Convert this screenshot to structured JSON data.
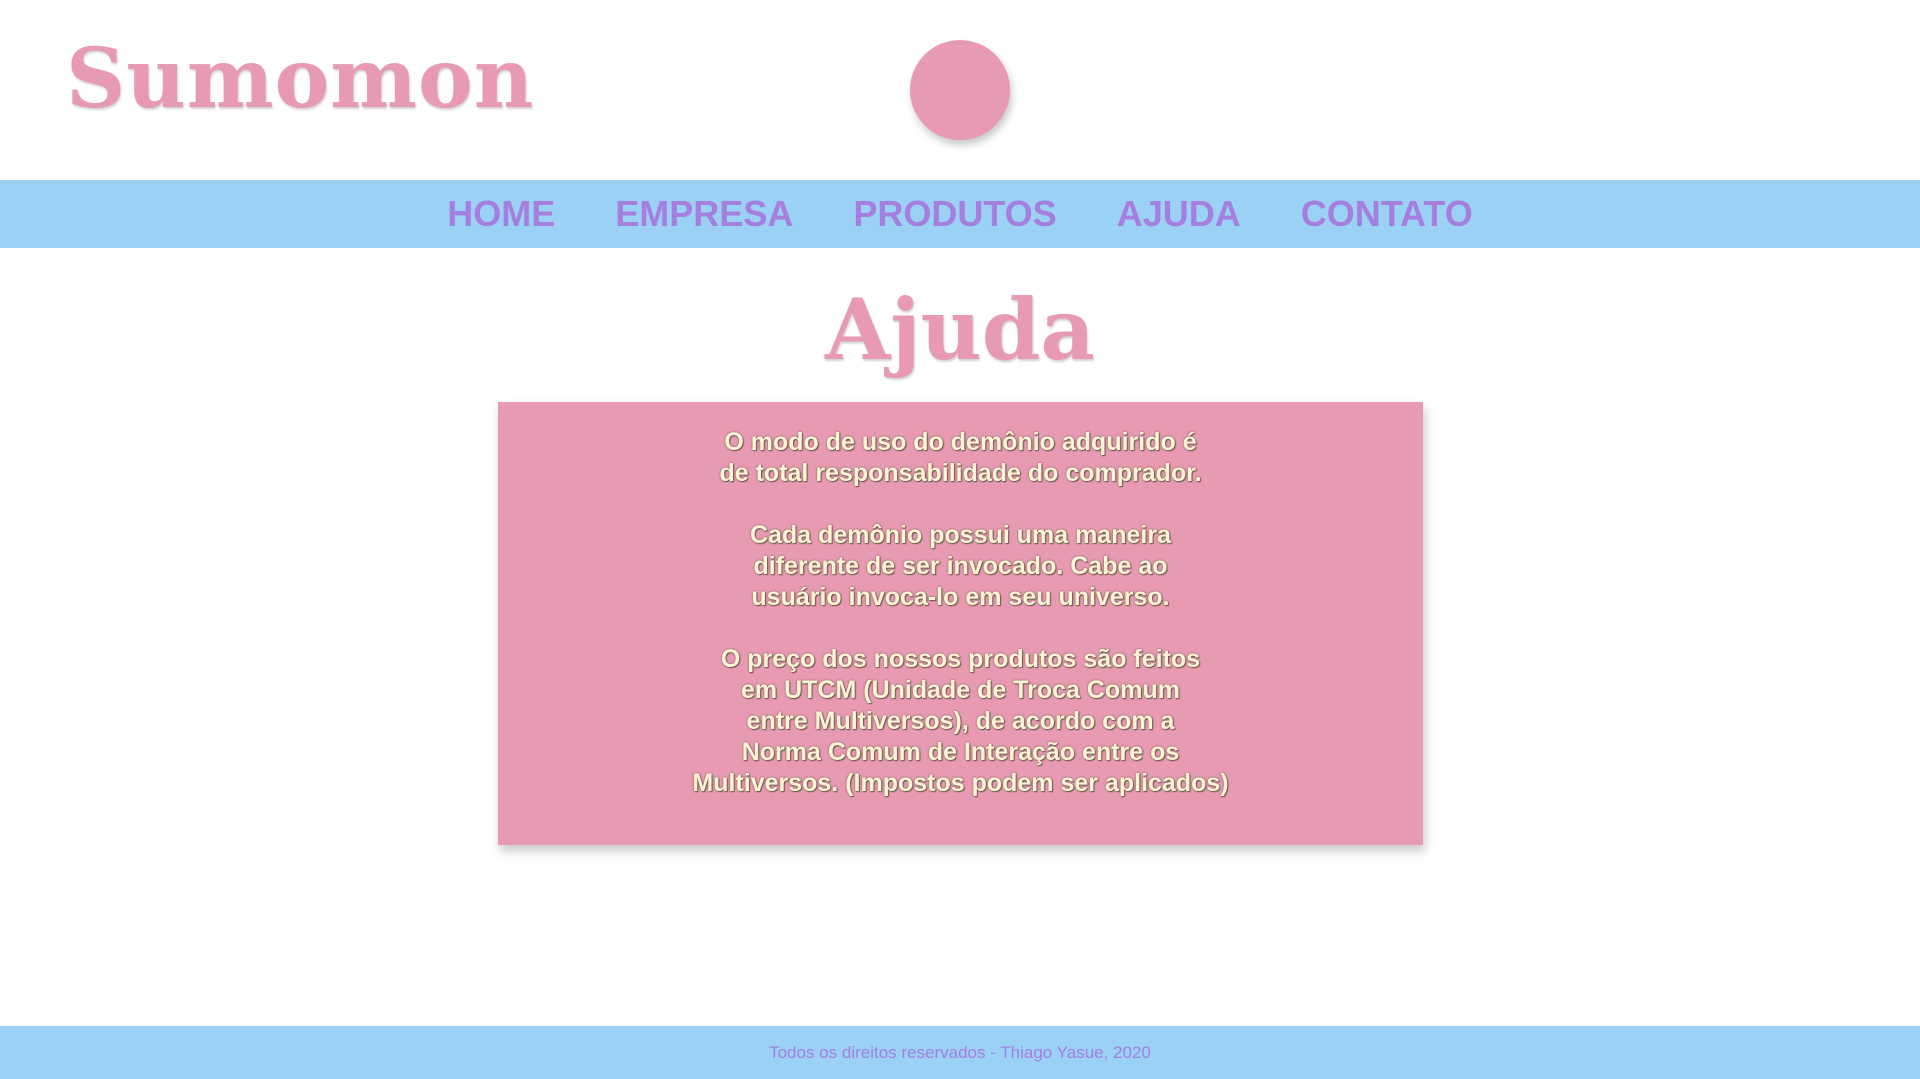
{
  "header": {
    "logo_text": "Sumomon"
  },
  "nav": {
    "items": [
      {
        "label": "HOME"
      },
      {
        "label": "EMPRESA"
      },
      {
        "label": "PRODUTOS"
      },
      {
        "label": "AJUDA"
      },
      {
        "label": "CONTATO"
      }
    ]
  },
  "main": {
    "title": "Ajuda",
    "paragraphs": [
      {
        "lines": [
          "O modo de uso do demônio adquirido é",
          "de total responsabilidade do comprador."
        ]
      },
      {
        "lines": [
          "Cada demônio possui uma maneira",
          "diferente de ser invocado. Cabe ao",
          "usuário invoca-lo em seu universo."
        ]
      },
      {
        "lines": [
          "O preço dos nossos produtos são feitos",
          "em UTCM (Unidade de Troca Comum",
          "entre Multiversos), de acordo com a",
          "Norma Comum de Interação entre os",
          "Multiversos. (Impostos podem ser aplicados)"
        ]
      }
    ]
  },
  "footer": {
    "text": "Todos os direitos reservados - Thiago Yasue, 2020"
  },
  "colors": {
    "pink": "#e89ab3",
    "nav_blue": "#9ad1f4",
    "purple": "#a57ee0",
    "cream": "#fff3d6"
  }
}
